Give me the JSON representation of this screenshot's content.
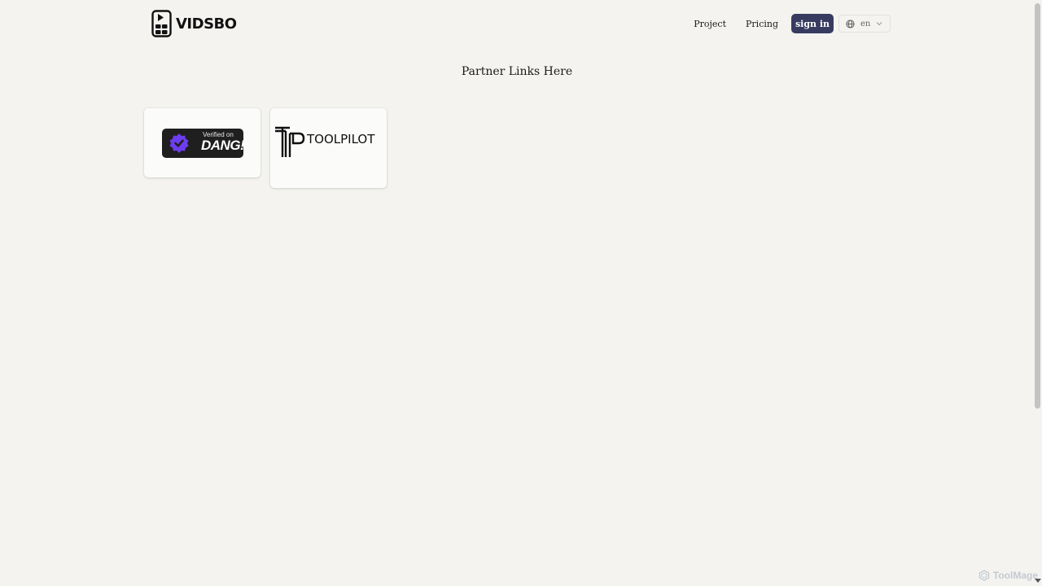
{
  "header": {
    "logo_text": "VIDSBO",
    "nav": {
      "project": "Project",
      "pricing": "Pricing",
      "sign_in": "sign in"
    },
    "language": {
      "value": "en",
      "icon": "globe-icon"
    }
  },
  "main": {
    "title": "Partner Links Here",
    "partners": [
      {
        "name": "DANG!",
        "badge_small": "Verified on",
        "badge_big": "DANG!",
        "colors": {
          "badge_bg": "#1f1f1f",
          "seal": "#6d3df0"
        }
      },
      {
        "name": "TOOLPILOT",
        "logo_text": "TOOLPILOT"
      }
    ]
  },
  "watermark": {
    "text": "ToolMage"
  },
  "colors": {
    "background": "#f4f3f0",
    "sign_in_button": "#383b60",
    "card": "#fbfbfa"
  }
}
